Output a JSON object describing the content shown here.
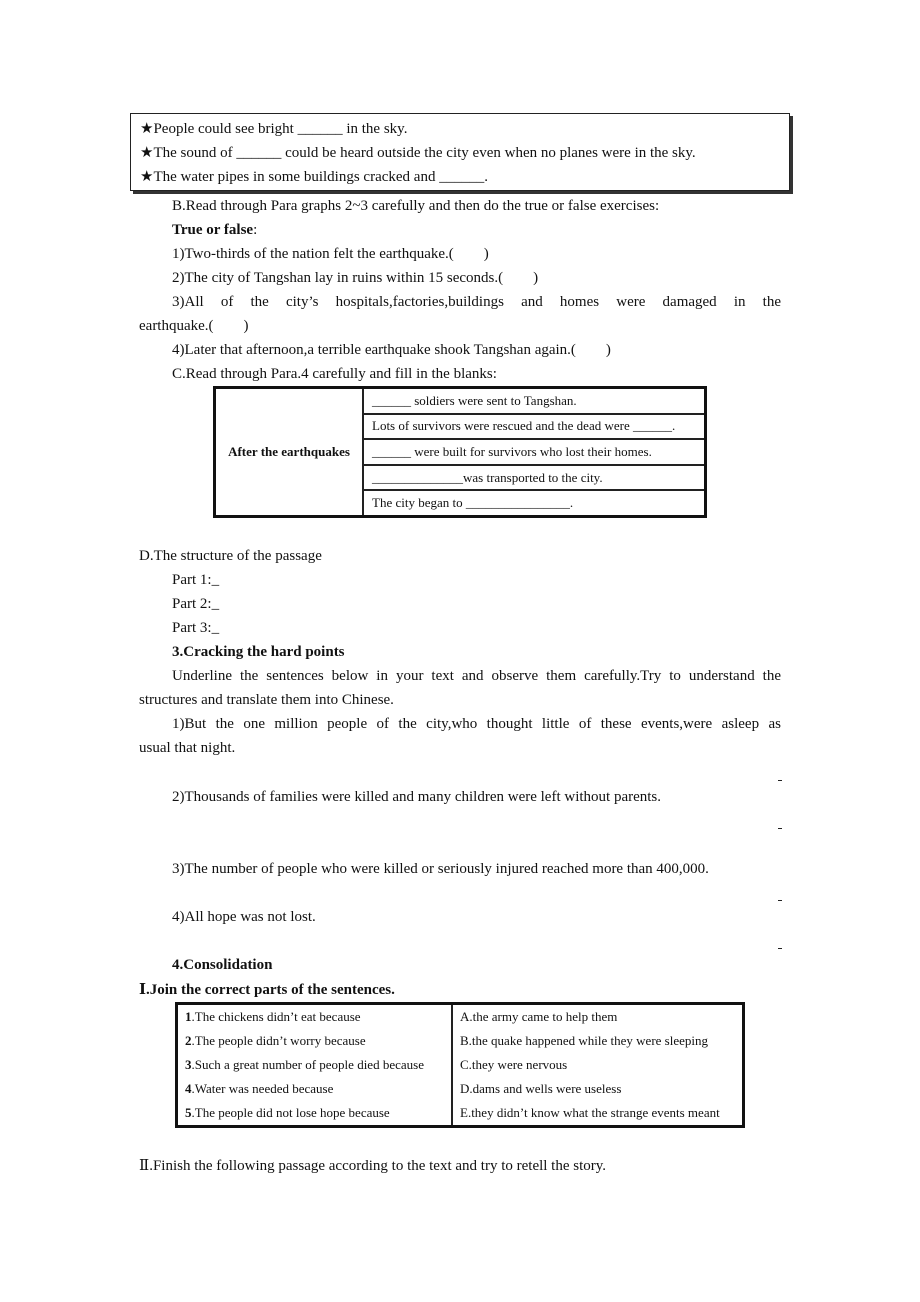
{
  "clue_box": {
    "icon": "★",
    "lines": [
      "People could see bright ______ in the sky.",
      "The sound of ______ could be heard outside the city even when no planes were in the sky.",
      "The water pipes in some buildings cracked and ______."
    ]
  },
  "section_b": {
    "instruction": "B.Read through Para graphs 2~3 carefully and then do the true or false exercises:",
    "heading_bold": "True or false",
    "heading_colon": ":",
    "items": [
      "1)Two-thirds of the nation felt the earthquake.(　　)",
      "2)The city of Tangshan lay in ruins within 15 seconds.(　　)",
      "3)All of the city’s hospitals,factories,buildings and homes were damaged in the",
      "earthquake.(　　)",
      "4)Later that afternoon,a terrible earthquake shook Tangshan again.(　　)"
    ]
  },
  "section_c": {
    "instruction": "C.Read through Para.4 carefully and fill in the blanks:",
    "table": {
      "row_header": "After the earthquakes",
      "rows": [
        "______ soldiers were sent to Tangshan.",
        "Lots of survivors were rescued and the dead were ______.",
        "______ were built for survivors who lost their homes.",
        "______________was transported to the city.",
        "The city began to ________________."
      ]
    }
  },
  "section_d": {
    "title": "D.The structure of the passage",
    "parts": [
      "Part 1:_",
      "Part 2:_",
      "Part 3:_"
    ]
  },
  "section_3": {
    "title": "3.Cracking the hard points",
    "instruction_line1": "Underline the sentences below in your text and observe them carefully.Try to understand the",
    "instruction_line2": "structures and translate them into Chinese.",
    "sentences": [
      "1)But the one million people of the city,who thought little of these events,were asleep as",
      "usual that night.",
      "2)Thousands of families were killed and many children were left without parents.",
      "3)The number of people who were killed or seriously injured reached more than 400,000.",
      "4)All hope was not lost."
    ]
  },
  "section_4": {
    "title": "4.Consolidation",
    "part1_title": "Ⅰ.Join the correct parts of the sentences.",
    "join_table": [
      {
        "num": "1",
        "left": ".The chickens didn’t eat because",
        "right": "A.the army came to help them"
      },
      {
        "num": "2",
        "left": ".The people didn’t worry because",
        "right": "B.the quake happened while they were sleeping"
      },
      {
        "num": "3",
        "left": ".Such a great number of people died because",
        "right": "C.they were nervous"
      },
      {
        "num": "4",
        "left": ".Water was needed because",
        "right": "D.dams and wells were useless"
      },
      {
        "num": "5",
        "left": ".The people did not lose hope because",
        "right": "E.they didn’t know what the strange events meant"
      }
    ],
    "part2_title": "Ⅱ.Finish the following passage according to the text and try to retell the story."
  }
}
